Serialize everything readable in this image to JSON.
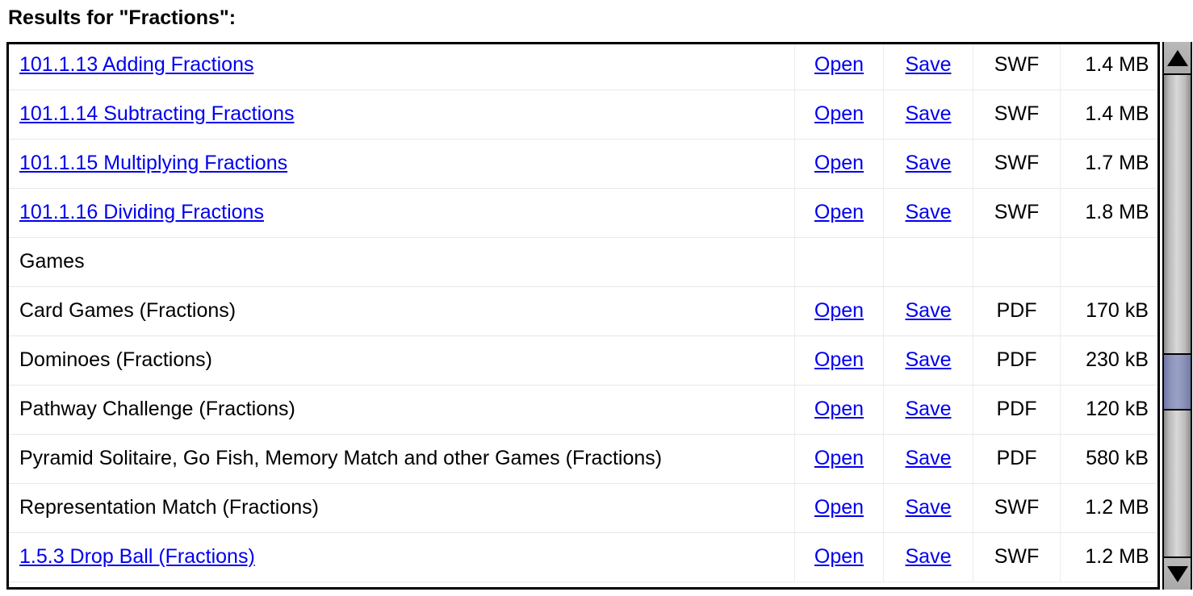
{
  "page_title": "Results for \"Fractions\":",
  "search_query": "Fractions",
  "actions": {
    "open_label": "Open",
    "save_label": "Save"
  },
  "colors": {
    "link": "#0000ee",
    "text": "#000000",
    "scrollbar_thumb": "#8f96bd",
    "row_separator": "#e8e8e8"
  },
  "scrollbar": {
    "up_arrow_icon": "triangle-up-icon",
    "down_arrow_icon": "triangle-down-icon",
    "thumb_top_percent": 58,
    "thumb_height_percent": 12
  },
  "results": {
    "rows": [
      {
        "title": "101.1.13 Adding Fractions",
        "is_link": true,
        "open": "Open",
        "save": "Save",
        "type": "SWF",
        "size": "1.4 MB",
        "has_actions": true
      },
      {
        "title": "101.1.14 Subtracting Fractions",
        "is_link": true,
        "open": "Open",
        "save": "Save",
        "type": "SWF",
        "size": "1.4 MB",
        "has_actions": true
      },
      {
        "title": "101.1.15 Multiplying Fractions",
        "is_link": true,
        "open": "Open",
        "save": "Save",
        "type": "SWF",
        "size": "1.7 MB",
        "has_actions": true
      },
      {
        "title": "101.1.16 Dividing Fractions",
        "is_link": true,
        "open": "Open",
        "save": "Save",
        "type": "SWF",
        "size": "1.8 MB",
        "has_actions": true
      },
      {
        "title": "Games",
        "is_link": false,
        "open": "",
        "save": "",
        "type": "",
        "size": "",
        "has_actions": false,
        "is_section": true
      },
      {
        "title": "Card Games (Fractions)",
        "is_link": false,
        "open": "Open",
        "save": "Save",
        "type": "PDF",
        "size": "170 kB",
        "has_actions": true
      },
      {
        "title": "Dominoes (Fractions)",
        "is_link": false,
        "open": "Open",
        "save": "Save",
        "type": "PDF",
        "size": "230 kB",
        "has_actions": true
      },
      {
        "title": "Pathway Challenge (Fractions)",
        "is_link": false,
        "open": "Open",
        "save": "Save",
        "type": "PDF",
        "size": "120 kB",
        "has_actions": true
      },
      {
        "title": "Pyramid Solitaire, Go Fish, Memory Match and other Games (Fractions)",
        "is_link": false,
        "open": "Open",
        "save": "Save",
        "type": "PDF",
        "size": "580 kB",
        "has_actions": true
      },
      {
        "title": "Representation Match (Fractions)",
        "is_link": false,
        "open": "Open",
        "save": "Save",
        "type": "SWF",
        "size": "1.2 MB",
        "has_actions": true
      },
      {
        "title": "1.5.3 Drop Ball (Fractions)",
        "is_link": true,
        "open": "Open",
        "save": "Save",
        "type": "SWF",
        "size": "1.2 MB",
        "has_actions": true
      }
    ]
  }
}
